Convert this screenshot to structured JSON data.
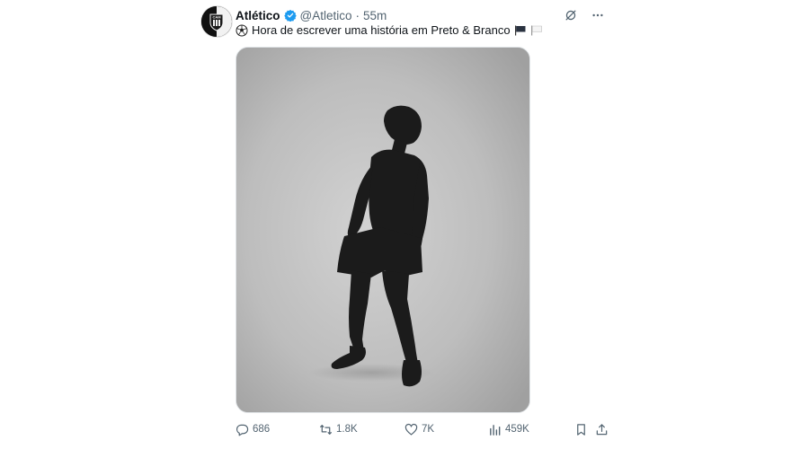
{
  "tweet": {
    "display_name": "Atlético",
    "handle": "@Atletico",
    "separator": "·",
    "time": "55m",
    "text": "Hora de escrever uma história em Preto & Branco",
    "emoji_prefix": "soccer-ball-emoji",
    "emoji_suffix": [
      "black-flag-emoji",
      "white-flag-emoji"
    ],
    "verified_color": "#1d9bf0"
  },
  "header_icons": [
    "grok-icon",
    "more-icon"
  ],
  "actions": {
    "replies": "686",
    "retweets": "1.8K",
    "likes": "7K",
    "views": "459K"
  },
  "colors": {
    "text_primary": "#0f1419",
    "text_secondary": "#536471",
    "accent": "#1d9bf0"
  }
}
